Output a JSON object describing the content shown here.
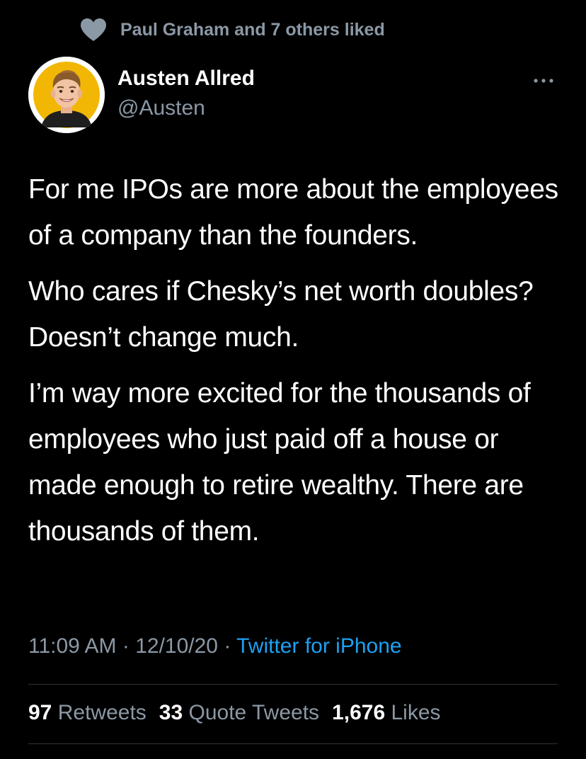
{
  "social_context": {
    "icon": "heart-icon",
    "text": "Paul Graham and 7 others liked"
  },
  "author": {
    "avatar_icon": "avatar-cartoon",
    "name": "Austen Allred",
    "handle": "@Austen"
  },
  "more_icon": "more-horizontal-icon",
  "tweet": {
    "paragraphs": [
      "For me IPOs are more about the employees of a company than the founders.",
      "Who cares if Chesky’s net worth doubles? Doesn’t change much.",
      "I’m way more excited for the thousands of employees who just paid off a house or made enough to retire wealthy. There are thousands of them."
    ]
  },
  "meta": {
    "time": "11:09 AM",
    "separator": "·",
    "date": "12/10/20",
    "source": "Twitter for iPhone"
  },
  "stats": {
    "retweets_count": "97",
    "retweets_label": "Retweets",
    "quote_count": "33",
    "quote_label": "Quote Tweets",
    "likes_count": "1,676",
    "likes_label": "Likes"
  },
  "colors": {
    "background": "#000000",
    "primary_text": "#ffffff",
    "secondary_text": "#8b98a5",
    "link": "#1da1f2",
    "divider": "#2f3336",
    "avatar_bg": "#f2b705"
  }
}
